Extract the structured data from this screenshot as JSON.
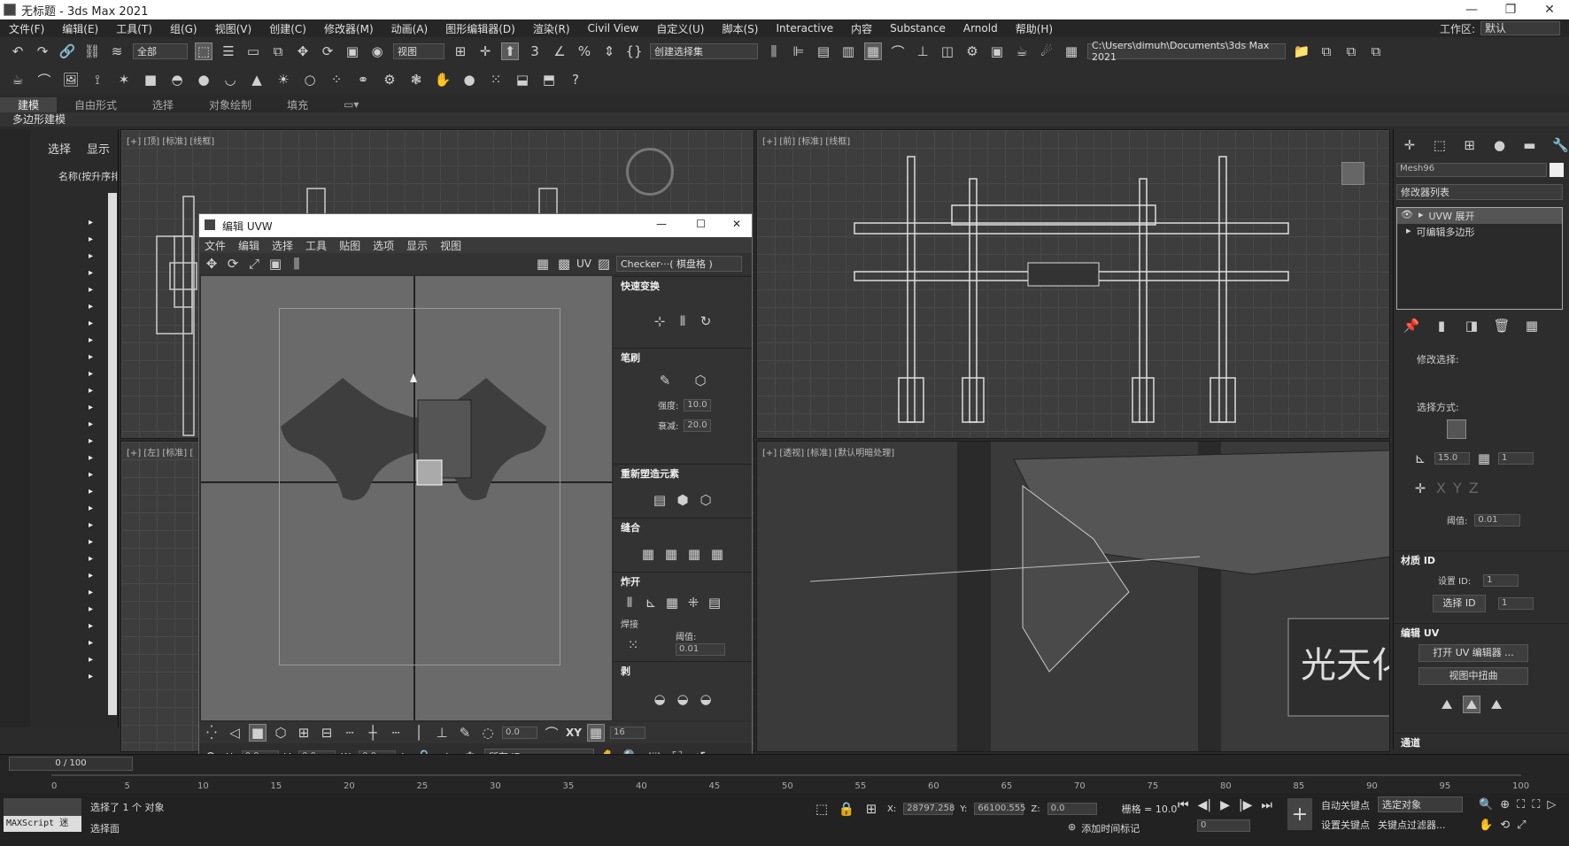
{
  "window": {
    "title": "无标题 - 3ds Max 2021"
  },
  "menu": [
    "文件(F)",
    "编辑(E)",
    "工具(T)",
    "组(G)",
    "视图(V)",
    "创建(C)",
    "修改器(M)",
    "动画(A)",
    "图形编辑器(D)",
    "渲染(R)",
    "Civil View",
    "自定义(U)",
    "脚本(S)",
    "Interactive",
    "内容",
    "Substance",
    "Arnold",
    "帮助(H)"
  ],
  "workspace": {
    "label": "工作区:",
    "value": "默认"
  },
  "toolbar1": {
    "filter": "全部",
    "ref_coord": "视图",
    "selset": "创建选择集",
    "path": "C:\\Users\\dimuh\\Documents\\3ds Max 2021"
  },
  "ribbon": {
    "tabs": [
      "建模",
      "自由形式",
      "选择",
      "对象绘制",
      "填充"
    ],
    "sub": "多边形建模"
  },
  "scene_explorer": {
    "tabs": [
      "选择",
      "显示"
    ],
    "header": "名称(按升序排"
  },
  "viewports": {
    "top": "[+] [顶] [标准] [线框]",
    "front": "[+] [前] [标准] [线框]",
    "left": "[+] [左] [标准] [",
    "persp": "[+] [透视] [标准] [默认明暗处理]"
  },
  "sign_text": "光天化日",
  "uvw": {
    "title": "编辑 UVW",
    "menu": [
      "文件",
      "编辑",
      "选择",
      "工具",
      "贴图",
      "选项",
      "显示",
      "视图"
    ],
    "uv_label": "UV",
    "checker": "Checker···( 棋盘格 )",
    "sections": {
      "quick": "快速变换",
      "brush": "笔刷",
      "strength_label": "强度:",
      "strength": "10.0",
      "falloff_label": "衰减:",
      "falloff": "20.0",
      "reshape": "重新塑造元素",
      "stitch": "缝合",
      "explode": "炸开",
      "weld": "焊接",
      "threshold_label": "阈值:",
      "threshold": "0.01",
      "peel": "剥"
    },
    "bottom": {
      "val1": "0.0",
      "xy": "XY",
      "val2": "16",
      "u": "0.0",
      "v": "0.0",
      "w": "0.0",
      "id_filter": "所有 ID"
    }
  },
  "cmd": {
    "obj_name": "Mesh96",
    "modlist_label": "修改器列表",
    "stack": [
      "UVW 展开",
      "可编辑多边形"
    ],
    "mod_select": "修改选择:",
    "select_by": "选择方式:",
    "angle": "15.0",
    "count": "1",
    "threshold_label": "阈值:",
    "threshold": "0.01",
    "mat_id": "材质 ID",
    "set_id": "设置 ID:",
    "set_id_val": "1",
    "select_id": "选择 ID",
    "select_id_val": "1",
    "edit_uv": "编辑 UV",
    "open_uv_editor": "打开 UV 编辑器 ...",
    "tweak_view": "视图中扭曲",
    "channel": "通道"
  },
  "timeline": {
    "frame": "0 / 100",
    "ticks": [
      "0",
      "5",
      "10",
      "15",
      "20",
      "25",
      "30",
      "35",
      "40",
      "45",
      "50",
      "55",
      "60",
      "65",
      "70",
      "75",
      "80",
      "85",
      "90",
      "95",
      "100"
    ]
  },
  "status": {
    "maxscript": "MAXScript 迷",
    "sel_count": "选择了 1 个 对象",
    "sel_mode": "选择面",
    "x": "28797.258",
    "y": "66100.555",
    "z": "0.0",
    "grid": "栅格 = 10.0",
    "add_time_tag": "添加时间标记",
    "auto_key": "自动关键点",
    "set_key": "设置关键点",
    "sel_obj": "选定对象",
    "key_filter": "关键点过滤器...",
    "frame": "0"
  }
}
